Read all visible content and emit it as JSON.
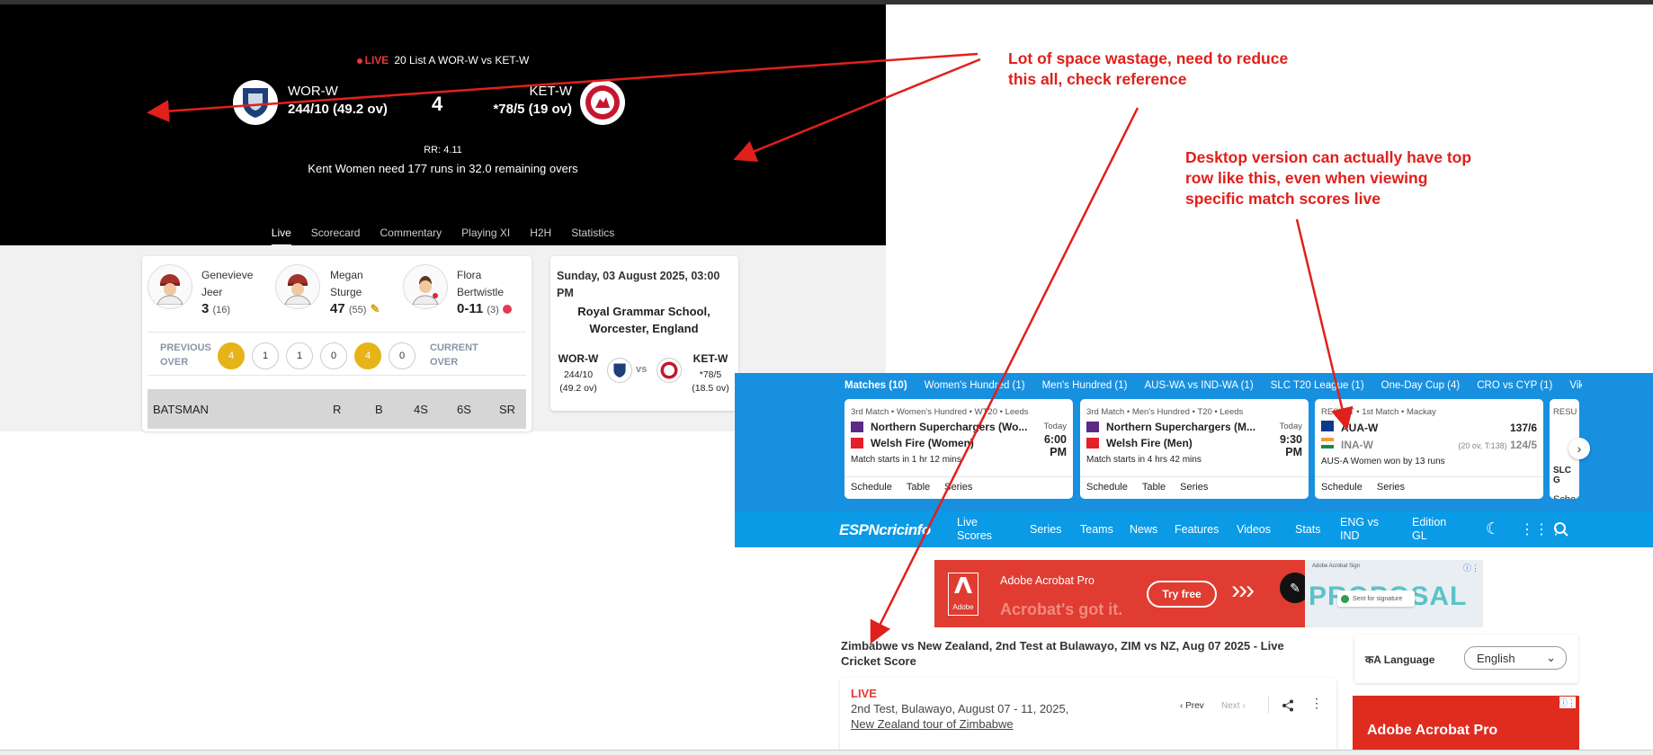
{
  "hero": {
    "live_label": "LIVE",
    "match_line": "20 List A WOR-W vs KET-W",
    "team1_name": "WOR-W",
    "team1_score": "244/10 (49.2 ov)",
    "team2_name": "KET-W",
    "team2_score": "*78/5 (19 ov)",
    "center_number": "4",
    "run_rate": "RR: 4.11",
    "need_text": "Kent Women need 177 runs in 32.0 remaining overs",
    "tabs": [
      "Live",
      "Scorecard",
      "Commentary",
      "Playing XI",
      "H2H",
      "Statistics"
    ]
  },
  "players": [
    {
      "first": "Genevieve",
      "last": "Jeer",
      "score": "3",
      "detail": "(16)"
    },
    {
      "first": "Megan",
      "last": "Sturge",
      "score": "47",
      "detail": "(55)"
    },
    {
      "first": "Flora",
      "last": "Bertwistle",
      "score": "0-11",
      "detail": "(3)"
    }
  ],
  "over": {
    "previous_label": [
      "PREVIOUS",
      "OVER"
    ],
    "current_label": [
      "CURRENT",
      "OVER"
    ],
    "balls": [
      "4",
      "1",
      "1",
      "0",
      "4",
      "0"
    ]
  },
  "batsman_table": {
    "headers": [
      "BATSMAN",
      "R",
      "B",
      "4S",
      "6S",
      "SR"
    ]
  },
  "match_info": {
    "date": "Sunday, 03 August 2025, 03:00",
    "date_pm": "PM",
    "venue": "Royal Grammar School, Worcester, England",
    "team1": "WOR-W",
    "team1_score": "244/10",
    "team1_overs": "(49.2 ov)",
    "team2": "KET-W",
    "team2_score": "*78/5",
    "team2_overs": "(18.5 ov)"
  },
  "annotations": {
    "a1_line1": "Lot of space wastage, need to reduce",
    "a1_line2": "this all, check reference",
    "a2_line1": "Desktop version can actually have top",
    "a2_line2": "row like this, even when viewing",
    "a2_line3": "specific match scores live"
  },
  "cricinfo": {
    "match_tabs": [
      "Matches (10)",
      "Women's Hundred (1)",
      "Men's Hundred (1)",
      "AUS-WA vs IND-WA (1)",
      "SLC T20 League (1)",
      "One-Day Cup (4)",
      "CRO vs CYP (1)",
      "Viking"
    ],
    "cards": [
      {
        "meta": "3rd Match • Women's Hundred • WT20 • Leeds",
        "team1": "Northern Superchargers (Wo...",
        "team2": "Welsh Fire (Women)",
        "day": "Today",
        "time": "6:00",
        "ampm": "PM",
        "status": "Match starts in 1 hr 12 mins",
        "links": [
          "Schedule",
          "Table",
          "Series"
        ]
      },
      {
        "meta": "3rd Match • Men's Hundred • T20 • Leeds",
        "team1": "Northern Superchargers (M...",
        "team2": "Welsh Fire (Men)",
        "day": "Today",
        "time": "9:30",
        "ampm": "PM",
        "status": "Match starts in 4 hrs 42 mins",
        "links": [
          "Schedule",
          "Table",
          "Series"
        ]
      },
      {
        "meta": "RESULT • 1st Match • Mackay",
        "team1": "AUA-W",
        "team1_score": "137/6",
        "team2": "INA-W",
        "team2_detail": "(20 ov, T:138)",
        "team2_score": "124/5",
        "status": "AUS-A Women won by 13 runs",
        "links": [
          "Schedule",
          "Series"
        ]
      },
      {
        "meta": "RESU",
        "status": "SLC G",
        "links": [
          "Sche"
        ]
      }
    ],
    "logo": "ESPNcricinfo",
    "nav_items": [
      "Live Scores",
      "Series",
      "Teams",
      "News",
      "Features",
      "Videos",
      "Stats",
      "ENG vs IND",
      "Edition GL"
    ],
    "ad": {
      "brand": "Adobe Acrobat Pro",
      "tagline": "Acrobat's got it.",
      "cta": "Try free",
      "proposal": "PROPOSAL",
      "sent": "Sent for signature",
      "mini_title": "Adobe Acrobat Sign",
      "adobe": "Adobe"
    },
    "page_title": "Zimbabwe vs New Zealand, 2nd Test at Bulawayo, ZIM vs NZ, Aug 07 2025 - Live Cricket Score",
    "live_label": "LIVE",
    "match_desc": "2nd Test, Bulawayo, August 07 - 11, 2025,",
    "tour_link": "New Zealand tour of Zimbabwe",
    "prev": "Prev",
    "next": "Next",
    "language_label": "Language",
    "language_value": "English",
    "ad2_brand": "Adobe Acrobat Pro"
  }
}
